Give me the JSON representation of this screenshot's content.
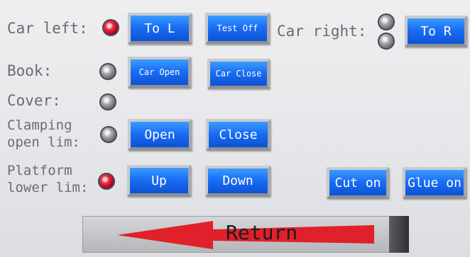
{
  "labels": {
    "car_left": "Car left:",
    "car_right": "Car right:",
    "book": "Book:",
    "cover": "Cover:",
    "clamping_1": "Clamping",
    "clamping_2": "open lim:",
    "platform_1": "Platform",
    "platform_2": "lower lim:"
  },
  "buttons": {
    "to_l": "To L",
    "test_off": "Test Off",
    "to_r": "To R",
    "car_open": "Car Open",
    "car_close": "Car Close",
    "open": "Open",
    "close": "Close",
    "up": "Up",
    "down": "Down",
    "cut_on": "Cut on",
    "glue_on": "Glue on"
  },
  "return": {
    "label": "Return"
  },
  "indicators": {
    "car_left": "on",
    "car_right_top": "off",
    "car_right_bottom": "off",
    "book": "off",
    "cover": "off",
    "clamping": "off",
    "platform": "on"
  },
  "colors": {
    "button_blue": "#1a6ef5",
    "indicator_on": "#f0304a",
    "indicator_off": "#a7a8ab",
    "return_arrow": "#e0202a"
  }
}
